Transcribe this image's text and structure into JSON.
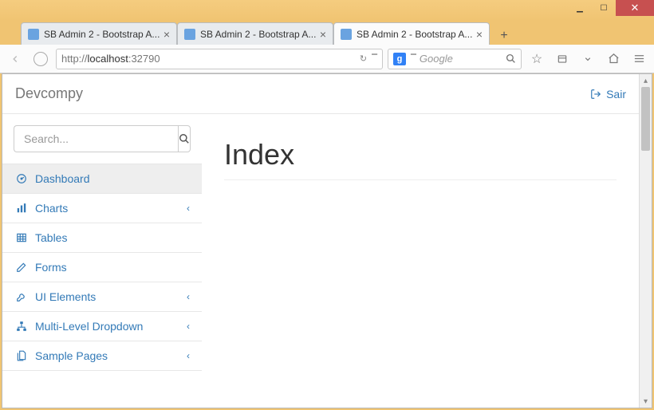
{
  "browser": {
    "tabs": [
      {
        "title": "SB Admin 2 - Bootstrap A..."
      },
      {
        "title": "SB Admin 2 - Bootstrap A..."
      },
      {
        "title": "SB Admin 2 - Bootstrap A..."
      }
    ],
    "url_prefix": "http://",
    "url_host": "localhost",
    "url_port": ":32790",
    "search_placeholder": "Google"
  },
  "app": {
    "brand": "Devcompy",
    "logout_label": "Sair",
    "search_placeholder": "Search...",
    "page_title": "Index",
    "nav": [
      {
        "label": "Dashboard"
      },
      {
        "label": "Charts"
      },
      {
        "label": "Tables"
      },
      {
        "label": "Forms"
      },
      {
        "label": "UI Elements"
      },
      {
        "label": "Multi-Level Dropdown"
      },
      {
        "label": "Sample Pages"
      }
    ]
  }
}
